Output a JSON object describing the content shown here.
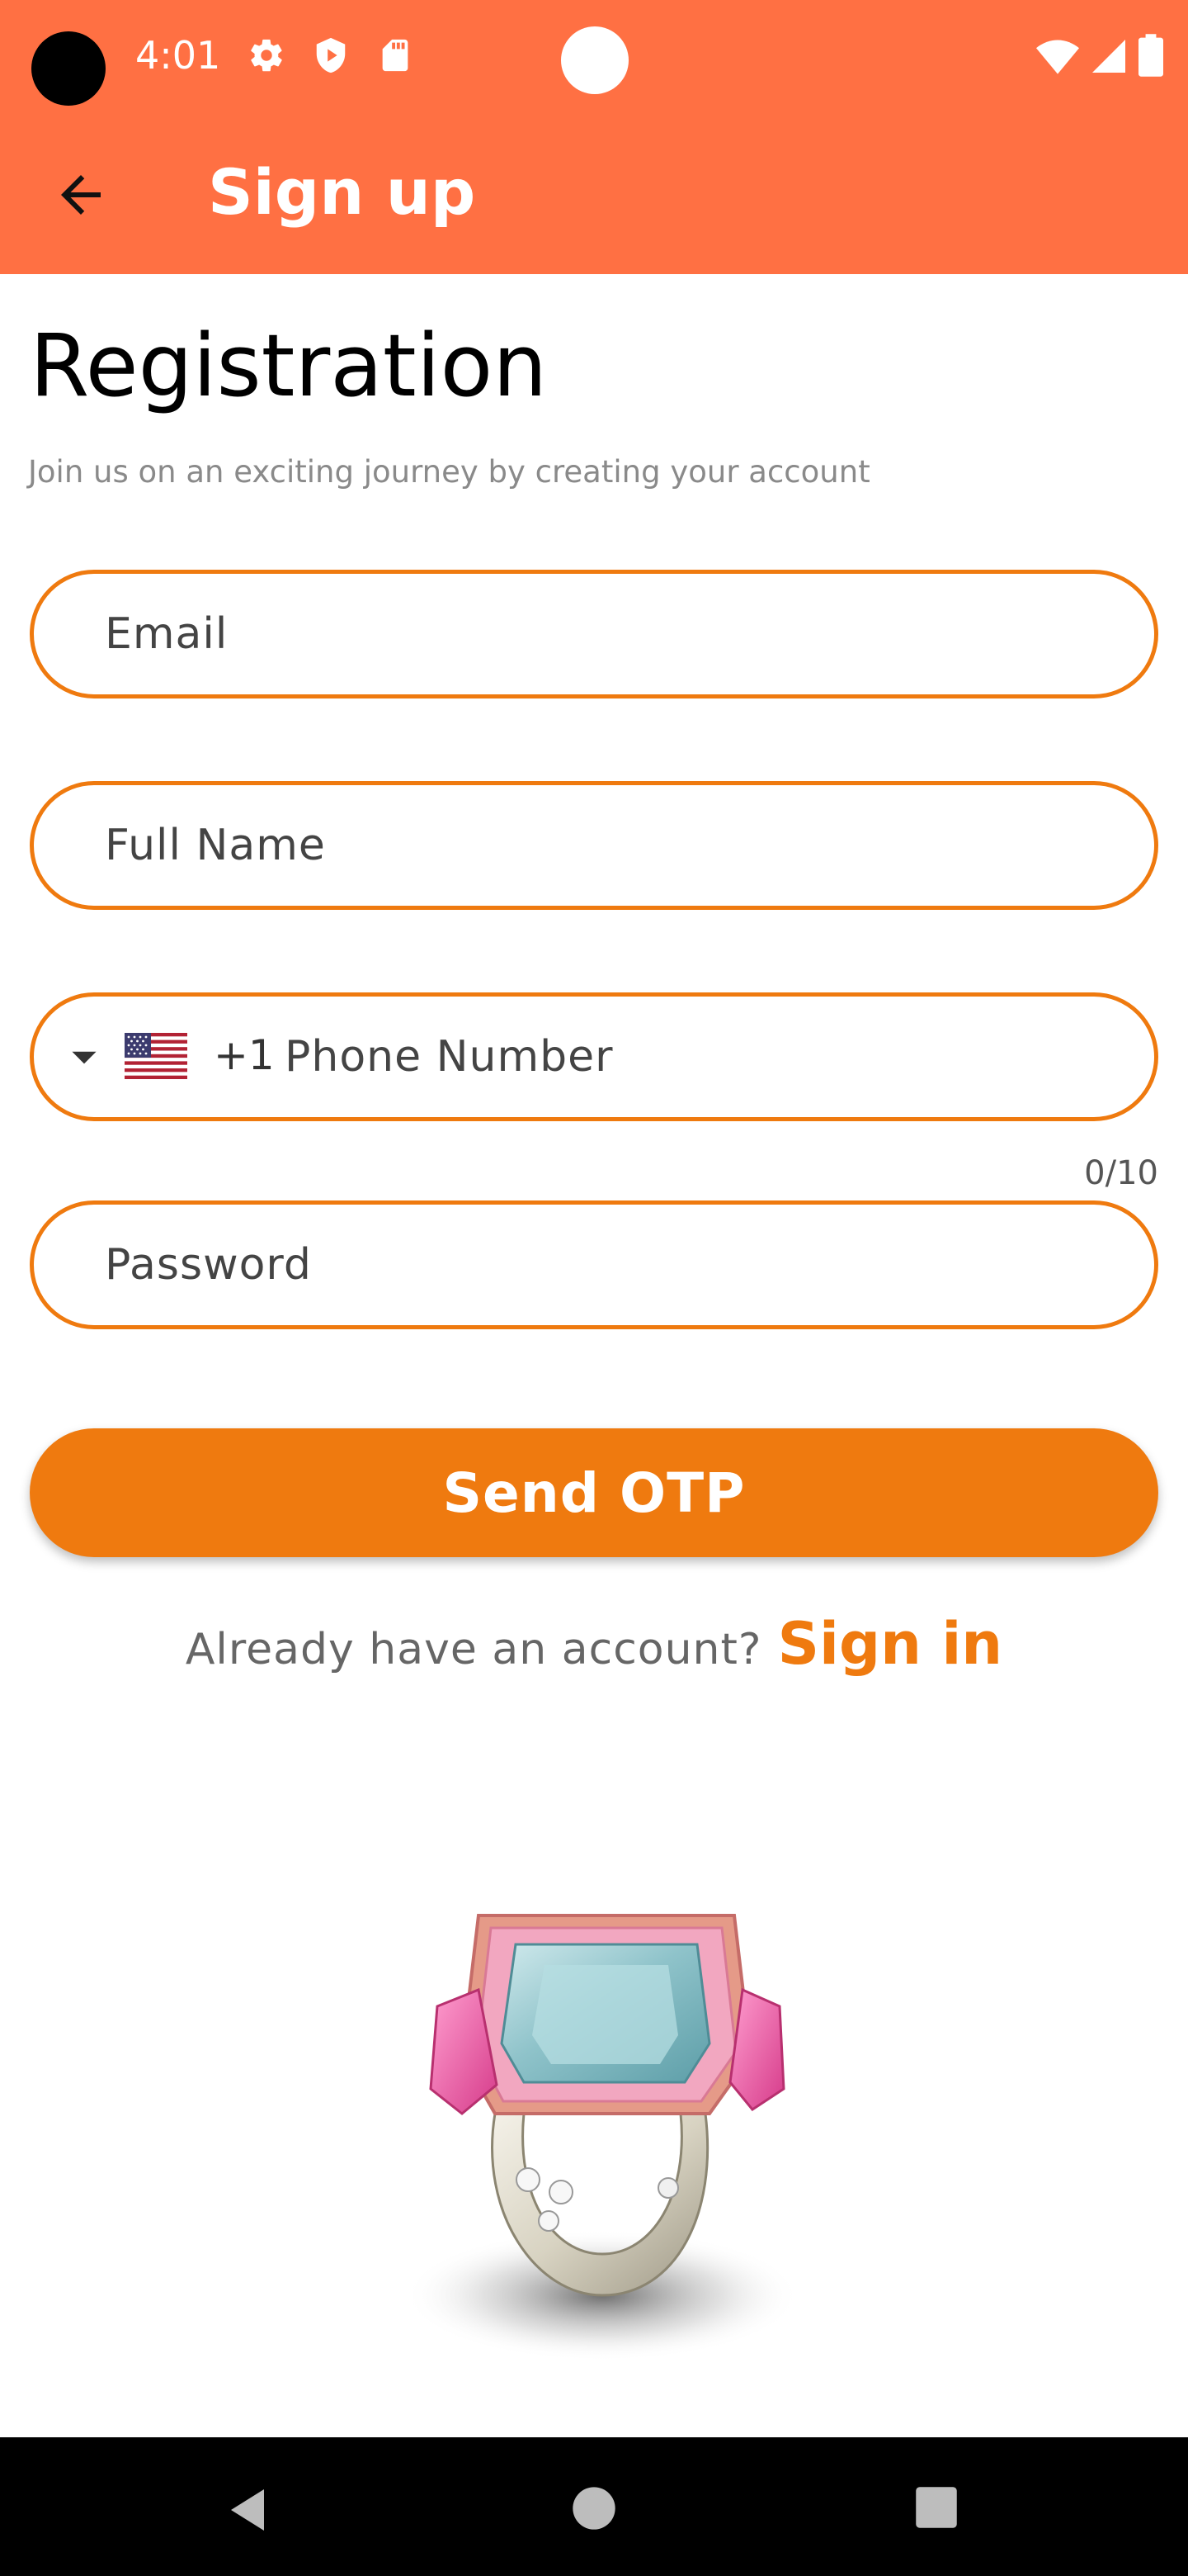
{
  "status_bar": {
    "time": "4:01",
    "icons": [
      "gear-icon",
      "shield-icon",
      "sd-card-icon",
      "wifi-icon",
      "signal-icon",
      "battery-icon"
    ]
  },
  "app_bar": {
    "title": "Sign up",
    "back_icon": "arrow-back-icon",
    "background_color": "#ff7043"
  },
  "form": {
    "heading": "Registration",
    "subheading": "Join us on an exciting journey by creating your account",
    "email_placeholder": "Email",
    "full_name_placeholder": "Full Name",
    "phone": {
      "flag_icon": "us-flag-icon",
      "dial_code": "+1",
      "placeholder": "Phone Number",
      "counter": "0/10"
    },
    "password_placeholder": "Password",
    "submit_label": "Send OTP",
    "accent_color": "#ef7a0f"
  },
  "signin": {
    "prompt": "Already have an account?",
    "link_label": "Sign in"
  },
  "hero_image": "ring-image",
  "nav_bar": {
    "buttons": [
      "back-triangle-icon",
      "home-circle-icon",
      "recents-square-icon"
    ]
  }
}
